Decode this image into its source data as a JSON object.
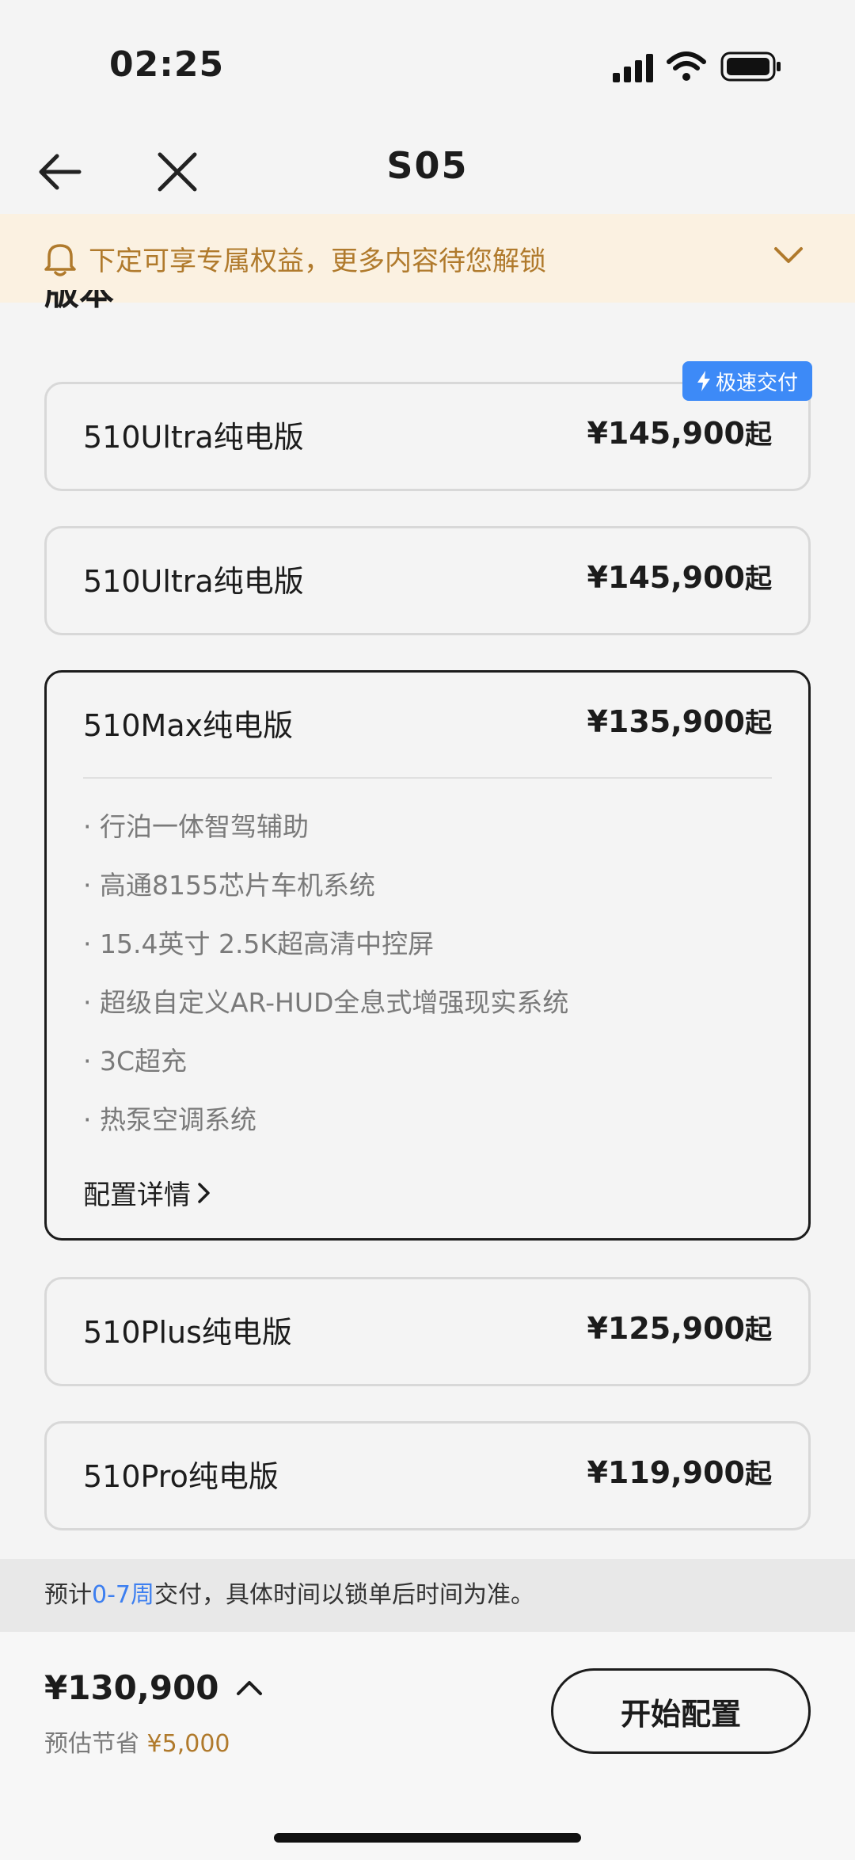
{
  "status": {
    "time": "02:25"
  },
  "nav": {
    "title": "S05"
  },
  "promo": {
    "text": "下定可享专属权益，更多内容待您解锁"
  },
  "section": {
    "title": "版本"
  },
  "badge": {
    "label": "极速交付"
  },
  "versions": [
    {
      "name": "510Ultra纯电版",
      "price": "¥145,900",
      "suffix": "起"
    },
    {
      "name": "510Ultra纯电版",
      "price": "¥145,900",
      "suffix": "起"
    },
    {
      "name": "510Max纯电版",
      "price": "¥135,900",
      "suffix": "起",
      "features": [
        "· 行泊一体智驾辅助",
        "· 高通8155芯片车机系统",
        "· 15.4英寸 2.5K超高清中控屏",
        "· 超级自定义AR-HUD全息式增强现实系统",
        "· 3C超充",
        "· 热泵空调系统"
      ],
      "detail_link": "配置详情"
    },
    {
      "name": "510Plus纯电版",
      "price": "¥125,900",
      "suffix": "起"
    },
    {
      "name": "510Pro纯电版",
      "price": "¥119,900",
      "suffix": "起"
    }
  ],
  "delivery": {
    "prefix": "预计",
    "highlight": "0-7周",
    "suffix": "交付，具体时间以锁单后时间为准。"
  },
  "summary": {
    "total": "¥130,900",
    "savings_label": "预估节省",
    "savings_amount": "¥5,000",
    "start_button": "开始配置"
  },
  "colors": {
    "accent_blue": "#3d8af7",
    "promo_gold": "#b07a2c",
    "promo_bg": "#fbf1e1"
  }
}
